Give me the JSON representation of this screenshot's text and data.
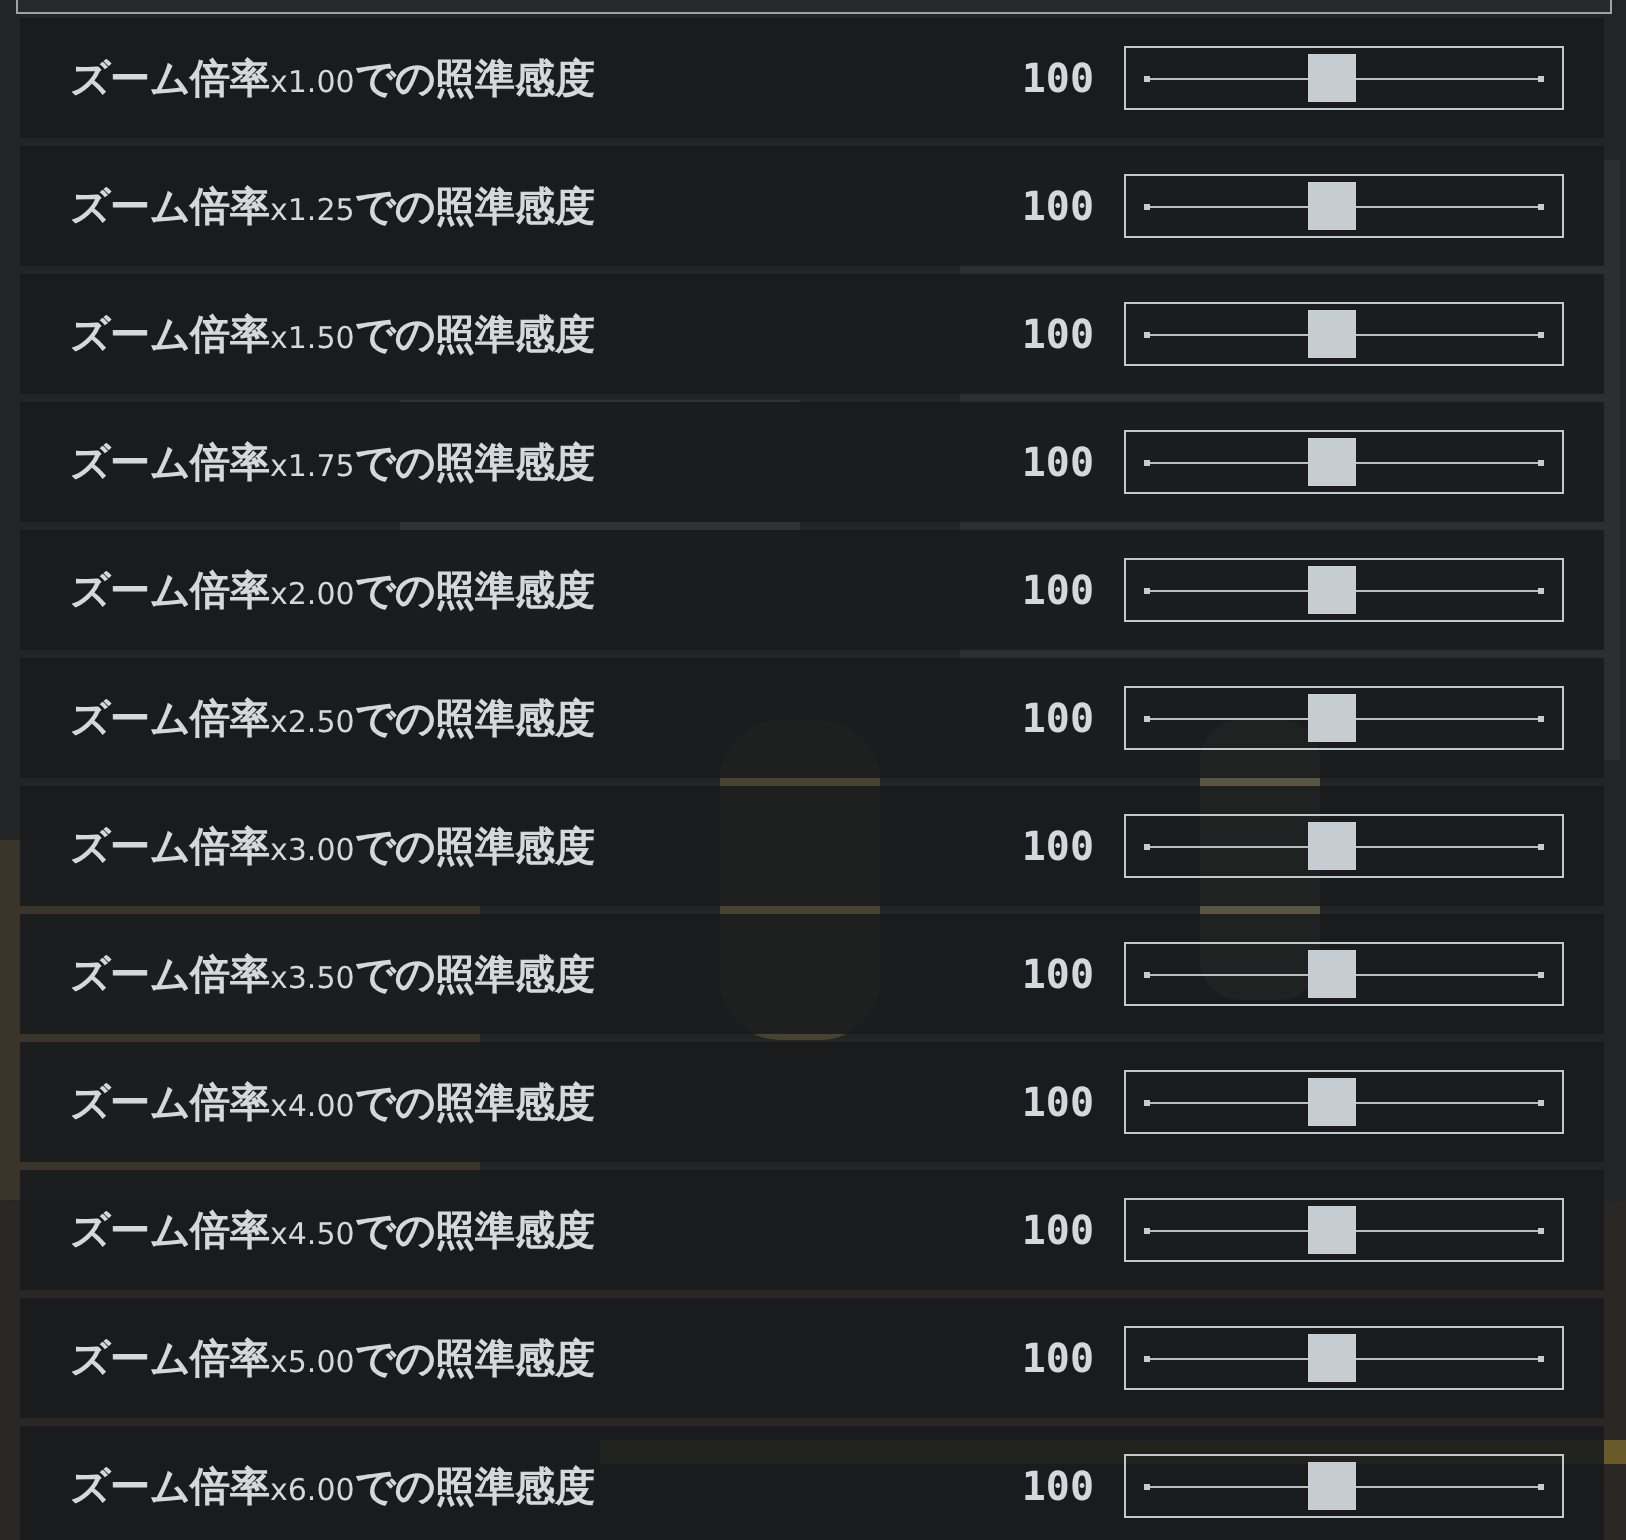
{
  "rows": [
    {
      "label_before": "ズーム倍率",
      "zoom": "x1.00",
      "label_after": "での照準感度",
      "value": "100",
      "level": 0.47
    },
    {
      "label_before": "ズーム倍率",
      "zoom": "x1.25",
      "label_after": "での照準感度",
      "value": "100",
      "level": 0.47
    },
    {
      "label_before": "ズーム倍率",
      "zoom": "x1.50",
      "label_after": "での照準感度",
      "value": "100",
      "level": 0.47
    },
    {
      "label_before": "ズーム倍率",
      "zoom": "x1.75",
      "label_after": "での照準感度",
      "value": "100",
      "level": 0.47
    },
    {
      "label_before": "ズーム倍率",
      "zoom": "x2.00",
      "label_after": "での照準感度",
      "value": "100",
      "level": 0.47
    },
    {
      "label_before": "ズーム倍率",
      "zoom": "x2.50",
      "label_after": "での照準感度",
      "value": "100",
      "level": 0.47
    },
    {
      "label_before": "ズーム倍率",
      "zoom": "x3.00",
      "label_after": "での照準感度",
      "value": "100",
      "level": 0.47
    },
    {
      "label_before": "ズーム倍率",
      "zoom": "x3.50",
      "label_after": "での照準感度",
      "value": "100",
      "level": 0.47
    },
    {
      "label_before": "ズーム倍率",
      "zoom": "x4.00",
      "label_after": "での照準感度",
      "value": "100",
      "level": 0.47
    },
    {
      "label_before": "ズーム倍率",
      "zoom": "x4.50",
      "label_after": "での照準感度",
      "value": "100",
      "level": 0.47
    },
    {
      "label_before": "ズーム倍率",
      "zoom": "x5.00",
      "label_after": "での照準感度",
      "value": "100",
      "level": 0.47
    },
    {
      "label_before": "ズーム倍率",
      "zoom": "x6.00",
      "label_after": "での照準感度",
      "value": "100",
      "level": 0.47
    }
  ]
}
